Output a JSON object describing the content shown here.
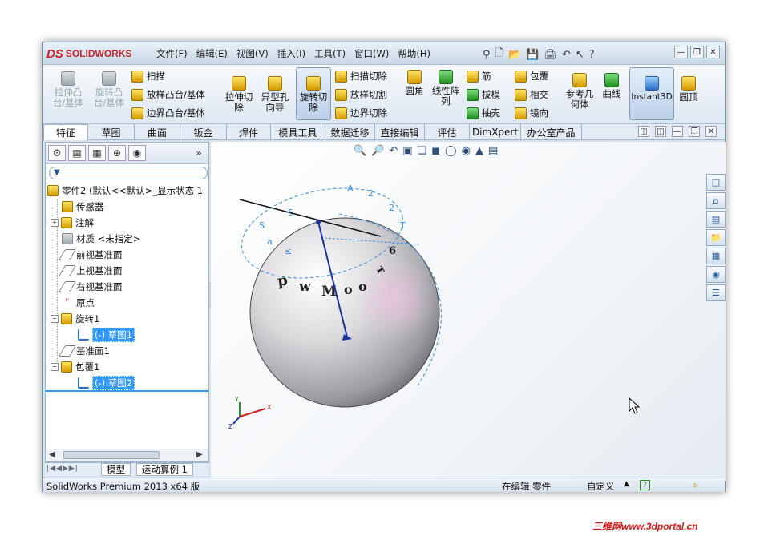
{
  "app": {
    "brand": "SOLIDWORKS",
    "brand_mark": "DS"
  },
  "menu": [
    "文件(F)",
    "编辑(E)",
    "视图(V)",
    "插入(I)",
    "工具(T)",
    "窗口(W)",
    "帮助(H)"
  ],
  "quick_access": [
    "新建",
    "打开",
    "保存",
    "打印",
    "撤销",
    "选择",
    "帮助"
  ],
  "window_controls": [
    "最小化",
    "还原",
    "关闭"
  ],
  "ribbon": {
    "extrude_boss": "拉伸凸台/基体",
    "revolve_boss": "旋转凸台/基体",
    "sweep": "扫描",
    "loft_boss": "放样凸台/基体",
    "boundary_boss": "边界凸台/基体",
    "extrude_cut": "拉伸切除",
    "hole_wizard": "异型孔向导",
    "revolve_cut": "旋转切除",
    "sweep_cut": "扫描切除",
    "loft_cut": "放样切割",
    "boundary_cut": "边界切除",
    "fillet": "圆角",
    "linear_pattern": "线性阵列",
    "rib": "筋",
    "draft": "拔模",
    "shell": "抽壳",
    "wrap": "包覆",
    "intersect": "相交",
    "mirror": "镜向",
    "ref_geometry": "参考几何体",
    "curves": "曲线",
    "instant3d": "Instant3D",
    "dome": "圆顶"
  },
  "tabs": [
    "特征",
    "草图",
    "曲面",
    "钣金",
    "焊件",
    "模具工具",
    "数据迁移",
    "直接编辑",
    "评估",
    "DimXpert",
    "办公室产品"
  ],
  "tree": {
    "root": "零件2 (默认<<默认>_显示状态 1",
    "sensors": "传感器",
    "annotations": "注解",
    "material": "材质 <未指定>",
    "front_plane": "前视基准面",
    "top_plane": "上视基准面",
    "right_plane": "右视基准面",
    "origin": "原点",
    "revolve1": "旋转1",
    "sketch1": "(-) 草图1",
    "plane1": "基准面1",
    "wrap1": "包覆1",
    "sketch2": "(-) 草图2"
  },
  "bottom_tabs": [
    "模型",
    "运动算例 1"
  ],
  "status": {
    "version": "SolidWorks Premium 2013 x64 版",
    "editing": "在编辑 零件",
    "custom": "自定义"
  },
  "watermark": "三维网www.3dportal.cn",
  "colors": {
    "accent": "#3399ff",
    "brand": "#c4272d",
    "sketch": "#3a8de0"
  }
}
